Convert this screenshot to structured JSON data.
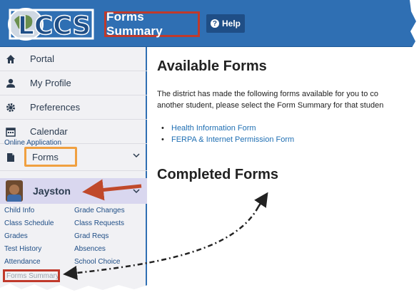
{
  "header": {
    "logo_text": "LCCS",
    "title": "Forms Summary",
    "help_label": "Help"
  },
  "sidebar": {
    "items": [
      {
        "label": "Portal",
        "icon": "home-icon"
      },
      {
        "label": "My Profile",
        "icon": "user-icon"
      },
      {
        "label": "Preferences",
        "icon": "gear-icon"
      },
      {
        "label": "Calendar",
        "icon": "calendar-icon"
      },
      {
        "label": "Forms",
        "icon": "document-icon"
      }
    ],
    "forms_submenu": [
      "Online Application"
    ],
    "student": {
      "name": "Jayston",
      "links_left": [
        "Child Info",
        "Class Schedule",
        "Grades",
        "Test History",
        "Attendance",
        "Forms Summary"
      ],
      "links_right": [
        "Grade Changes",
        "Class Requests",
        "Grad Reqs",
        "Absences",
        "School Choice"
      ]
    }
  },
  "main": {
    "available_heading": "Available Forms",
    "description_line1": "The district has made the following forms available for you to co",
    "description_line2": "another student, please select the Form Summary for that studen",
    "forms": [
      "Health Information Form",
      "FERPA & Internet Permission Form"
    ],
    "completed_heading": "Completed Forms"
  },
  "colors": {
    "header_blue": "#2f6fb3",
    "highlight_red": "#c0392b",
    "highlight_orange": "#f0a040",
    "student_row": "#d9d7ef",
    "link_blue": "#1f6fb3"
  }
}
